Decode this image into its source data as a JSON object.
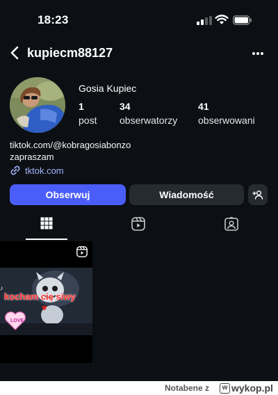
{
  "status_bar": {
    "time": "18:23"
  },
  "header": {
    "username": "kupiecm88127"
  },
  "profile": {
    "full_name": "Gosia Kupiec",
    "stats": [
      {
        "value": "1",
        "label": "post"
      },
      {
        "value": "34",
        "label": "obserwatorzy"
      },
      {
        "value": "41",
        "label": "obserwowani"
      }
    ],
    "bio": {
      "link_line": "tiktok.com/@kobragosiabonzo",
      "text": "zapraszam",
      "website": "tktok.com"
    }
  },
  "actions": {
    "follow_label": "Obserwuj",
    "message_label": "Wiadomość"
  },
  "tabs": [
    {
      "name": "grid",
      "icon": "grid-icon",
      "active": true
    },
    {
      "name": "reels",
      "icon": "reels-icon",
      "active": false
    },
    {
      "name": "tagged",
      "icon": "tagged-icon",
      "active": false
    }
  ],
  "posts": [
    {
      "type": "reel",
      "overlay_text": "kocham cię siwy",
      "sticker_text": "LOVE"
    }
  ],
  "colors": {
    "background": "#0c1014",
    "follow_button": "#4a5df9",
    "secondary_button": "#262a31",
    "link": "#a5b4ff"
  },
  "footer": {
    "author": "Notabene",
    "separator": "z",
    "site": "wykop.pl"
  }
}
